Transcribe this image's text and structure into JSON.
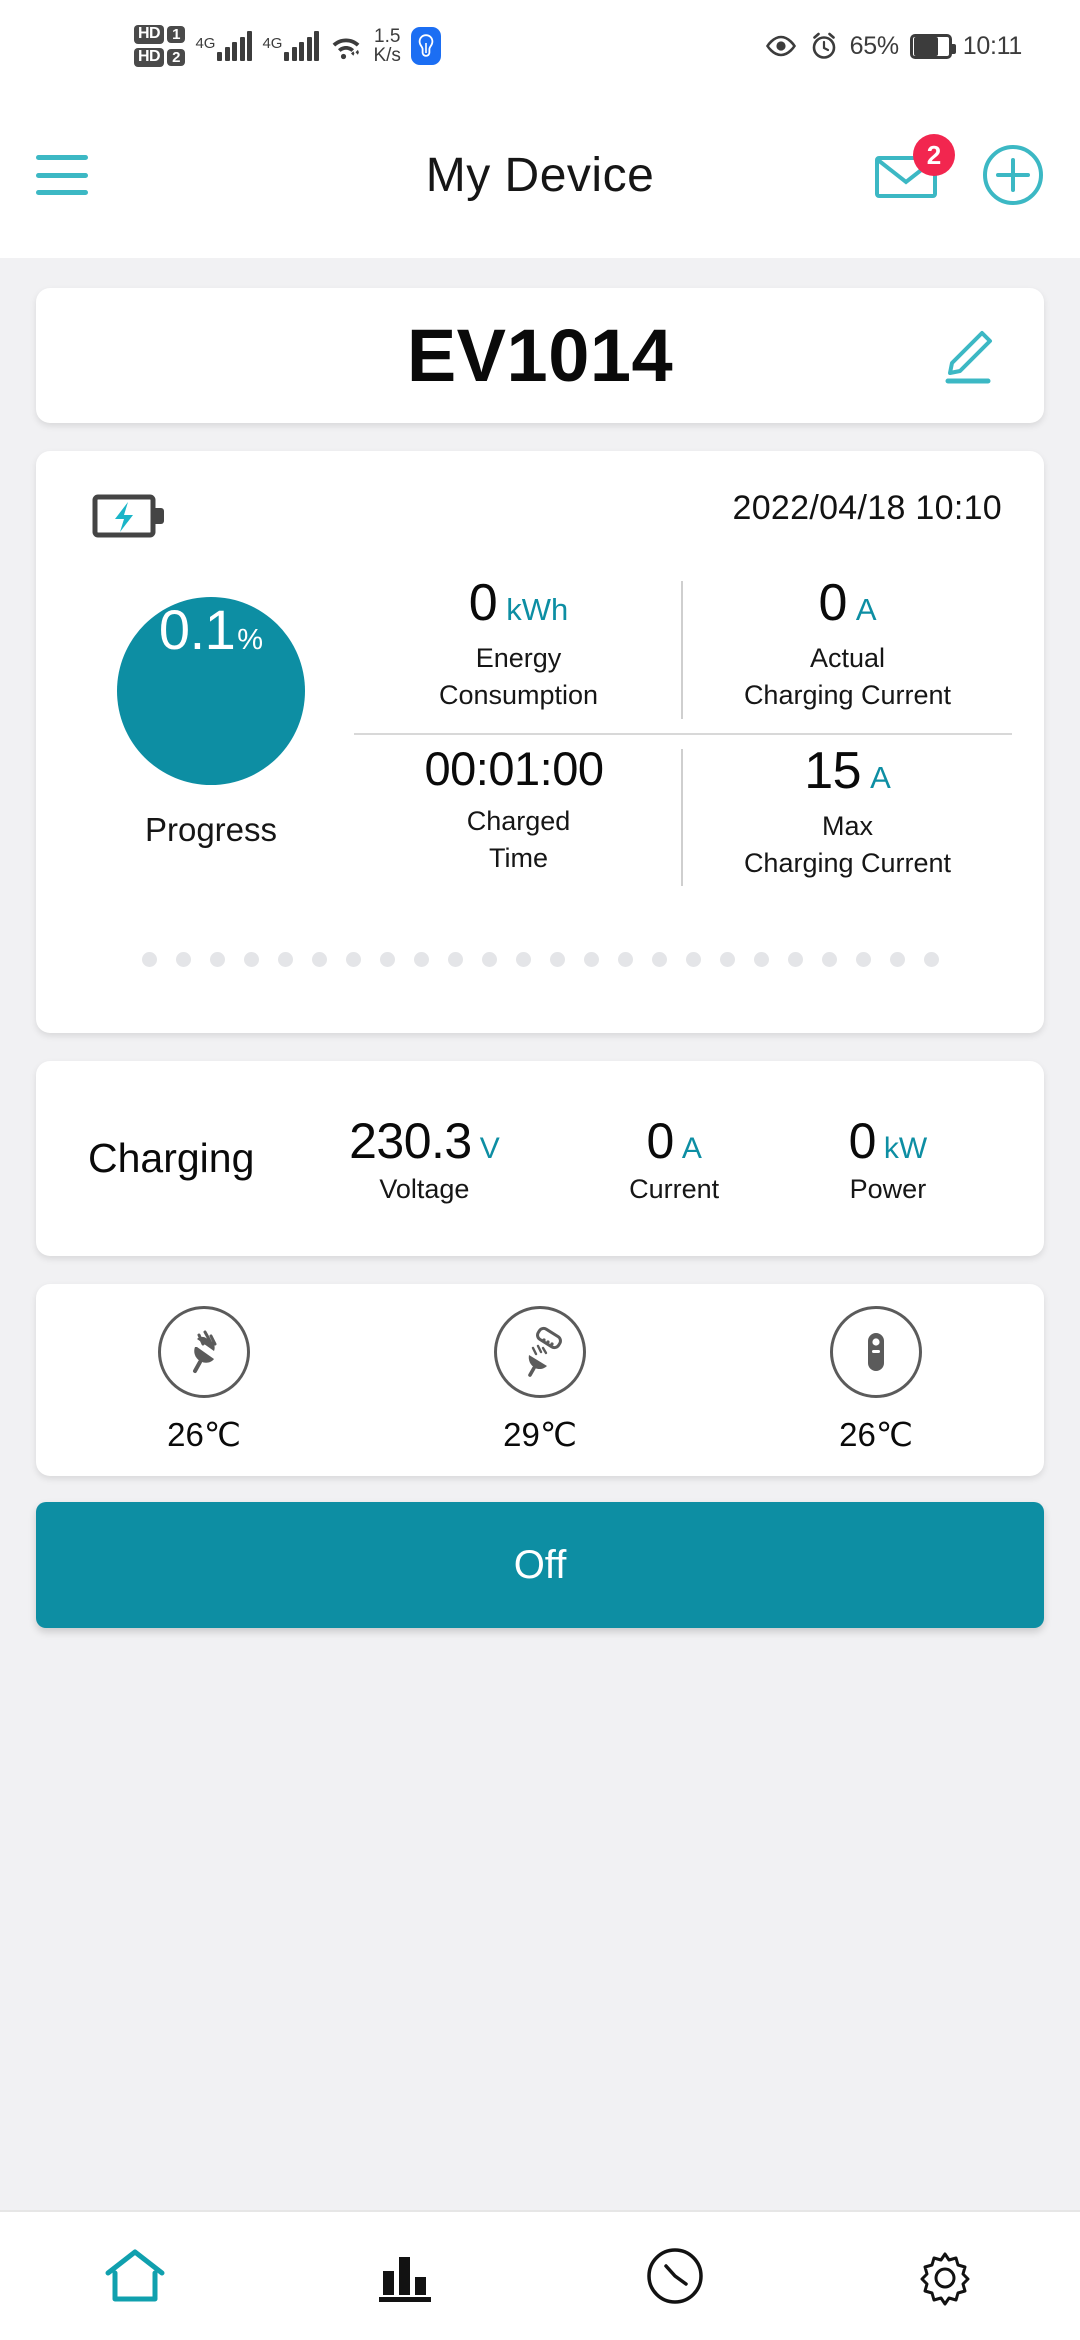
{
  "status_bar": {
    "hd1_label": "HD",
    "hd1_num": "1",
    "hd2_label": "HD",
    "hd2_num": "2",
    "sim1_network": "4G",
    "sim2_network": "4G",
    "network_speed": "1.5",
    "network_speed_unit": "K/s",
    "battery_percent": "65%",
    "time": "10:11",
    "icons": [
      "hd-badge-icon",
      "signal-bars-icon",
      "wifi-icon",
      "lightbulb-icon",
      "eye-icon",
      "alarm-clock-icon",
      "battery-icon"
    ]
  },
  "header": {
    "title": "My Device",
    "menu_icon": "hamburger-menu-icon",
    "mail_icon": "mail-icon",
    "mail_badge": "2",
    "add_icon": "add-circle-icon"
  },
  "device": {
    "name": "EV1014",
    "edit_icon": "pencil-edit-icon"
  },
  "status_card": {
    "charging_icon": "battery-charging-icon",
    "timestamp": "2022/04/18 10:10",
    "progress": {
      "value": "0.1",
      "unit": "%",
      "label": "Progress",
      "color": "#0d8ea3"
    },
    "metrics": [
      {
        "value": "0",
        "unit": "kWh",
        "label": "Energy\nConsumption",
        "label_line1": "Energy",
        "label_line2": "Consumption"
      },
      {
        "value": "0",
        "unit": "A",
        "label_line1": "Actual",
        "label_line2": "Charging Current"
      },
      {
        "value": "00:01:00",
        "unit": "",
        "label_line1": "Charged",
        "label_line2": "Time"
      },
      {
        "value": "15",
        "unit": "A",
        "label_line1": "Max",
        "label_line2": "Charging Current"
      }
    ],
    "dot_count": 24
  },
  "charging_card": {
    "title": "Charging",
    "metrics": [
      {
        "value": "230.3",
        "unit": "V",
        "label": "Voltage"
      },
      {
        "value": "0",
        "unit": "A",
        "label": "Current"
      },
      {
        "value": "0",
        "unit": "kW",
        "label": "Power"
      }
    ]
  },
  "temperature_card": {
    "items": [
      {
        "icon": "power-plug-icon",
        "value": "26℃"
      },
      {
        "icon": "plug-socket-icon",
        "value": "29℃"
      },
      {
        "icon": "ev-connector-icon",
        "value": "26℃"
      }
    ]
  },
  "power_button": {
    "label": "Off",
    "color": "#0d8ea3"
  },
  "bottom_nav": {
    "items": [
      {
        "icon": "home-icon",
        "active": true
      },
      {
        "icon": "bar-chart-icon",
        "active": false
      },
      {
        "icon": "clock-icon",
        "active": false
      },
      {
        "icon": "gear-settings-icon",
        "active": false
      }
    ]
  },
  "theme": {
    "accent": "#0d8ea3",
    "accent_light": "#3cb8c4",
    "badge_red": "#f2264f",
    "background": "#f1f1f3"
  }
}
